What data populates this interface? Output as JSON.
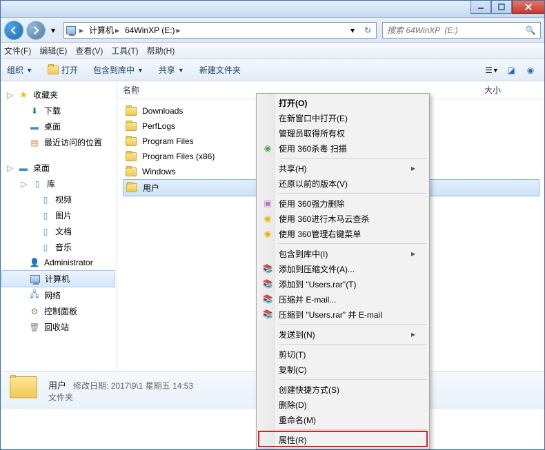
{
  "window": {
    "title": ""
  },
  "nav": {
    "crumbs": [
      "计算机",
      "64WinXP  (E:)"
    ],
    "search_placeholder": "搜索 64WinXP  (E:)"
  },
  "menubar": [
    "文件(F)",
    "编辑(E)",
    "查看(V)",
    "工具(T)",
    "帮助(H)"
  ],
  "toolbar": {
    "organize": "组织",
    "open": "打开",
    "include": "包含到库中",
    "share": "共享",
    "new_folder": "新建文件夹"
  },
  "columns": {
    "name": "名称",
    "size": "大小"
  },
  "sidebar": {
    "favorites": {
      "label": "收藏夹",
      "items": [
        "下载",
        "桌面",
        "最近访问的位置"
      ]
    },
    "desktop": {
      "label": "桌面",
      "library": {
        "label": "库",
        "items": [
          "视频",
          "图片",
          "文档",
          "音乐"
        ]
      },
      "admin": "Administrator",
      "computer": "计算机",
      "network": "网络",
      "control_panel": "控制面板",
      "recycle": "回收站"
    }
  },
  "files": [
    {
      "name": "Downloads"
    },
    {
      "name": "PerfLogs"
    },
    {
      "name": "Program Files"
    },
    {
      "name": "Program Files (x86)"
    },
    {
      "name": "Windows"
    },
    {
      "name": "用户",
      "selected": true
    }
  ],
  "details": {
    "name": "用户",
    "date_label": "修改日期:",
    "date": "2017\\9\\1 星期五 14:53",
    "type": "文件夹"
  },
  "context_menu": {
    "open": "打开(O)",
    "open_new": "在新窗口中打开(E)",
    "admin_own": "管理员取得所有权",
    "scan_360": "使用 360杀毒 扫描",
    "share": "共享(H)",
    "restore": "还原以前的版本(V)",
    "force_del": "使用 360强力删除",
    "trojan": "使用 360进行木马云查杀",
    "ctx_mgr": "使用 360管理右键菜单",
    "include_lib": "包含到库中(I)",
    "add_archive": "添加到压缩文件(A)...",
    "add_rar": "添加到 \"Users.rar\"(T)",
    "zip_email": "压缩并 E-mail...",
    "zip_rar_email": "压缩到 \"Users.rar\" 并 E-mail",
    "send_to": "发送到(N)",
    "cut": "剪切(T)",
    "copy": "复制(C)",
    "shortcut": "创建快捷方式(S)",
    "delete": "删除(D)",
    "rename": "重命名(M)",
    "props": "属性(R)"
  }
}
